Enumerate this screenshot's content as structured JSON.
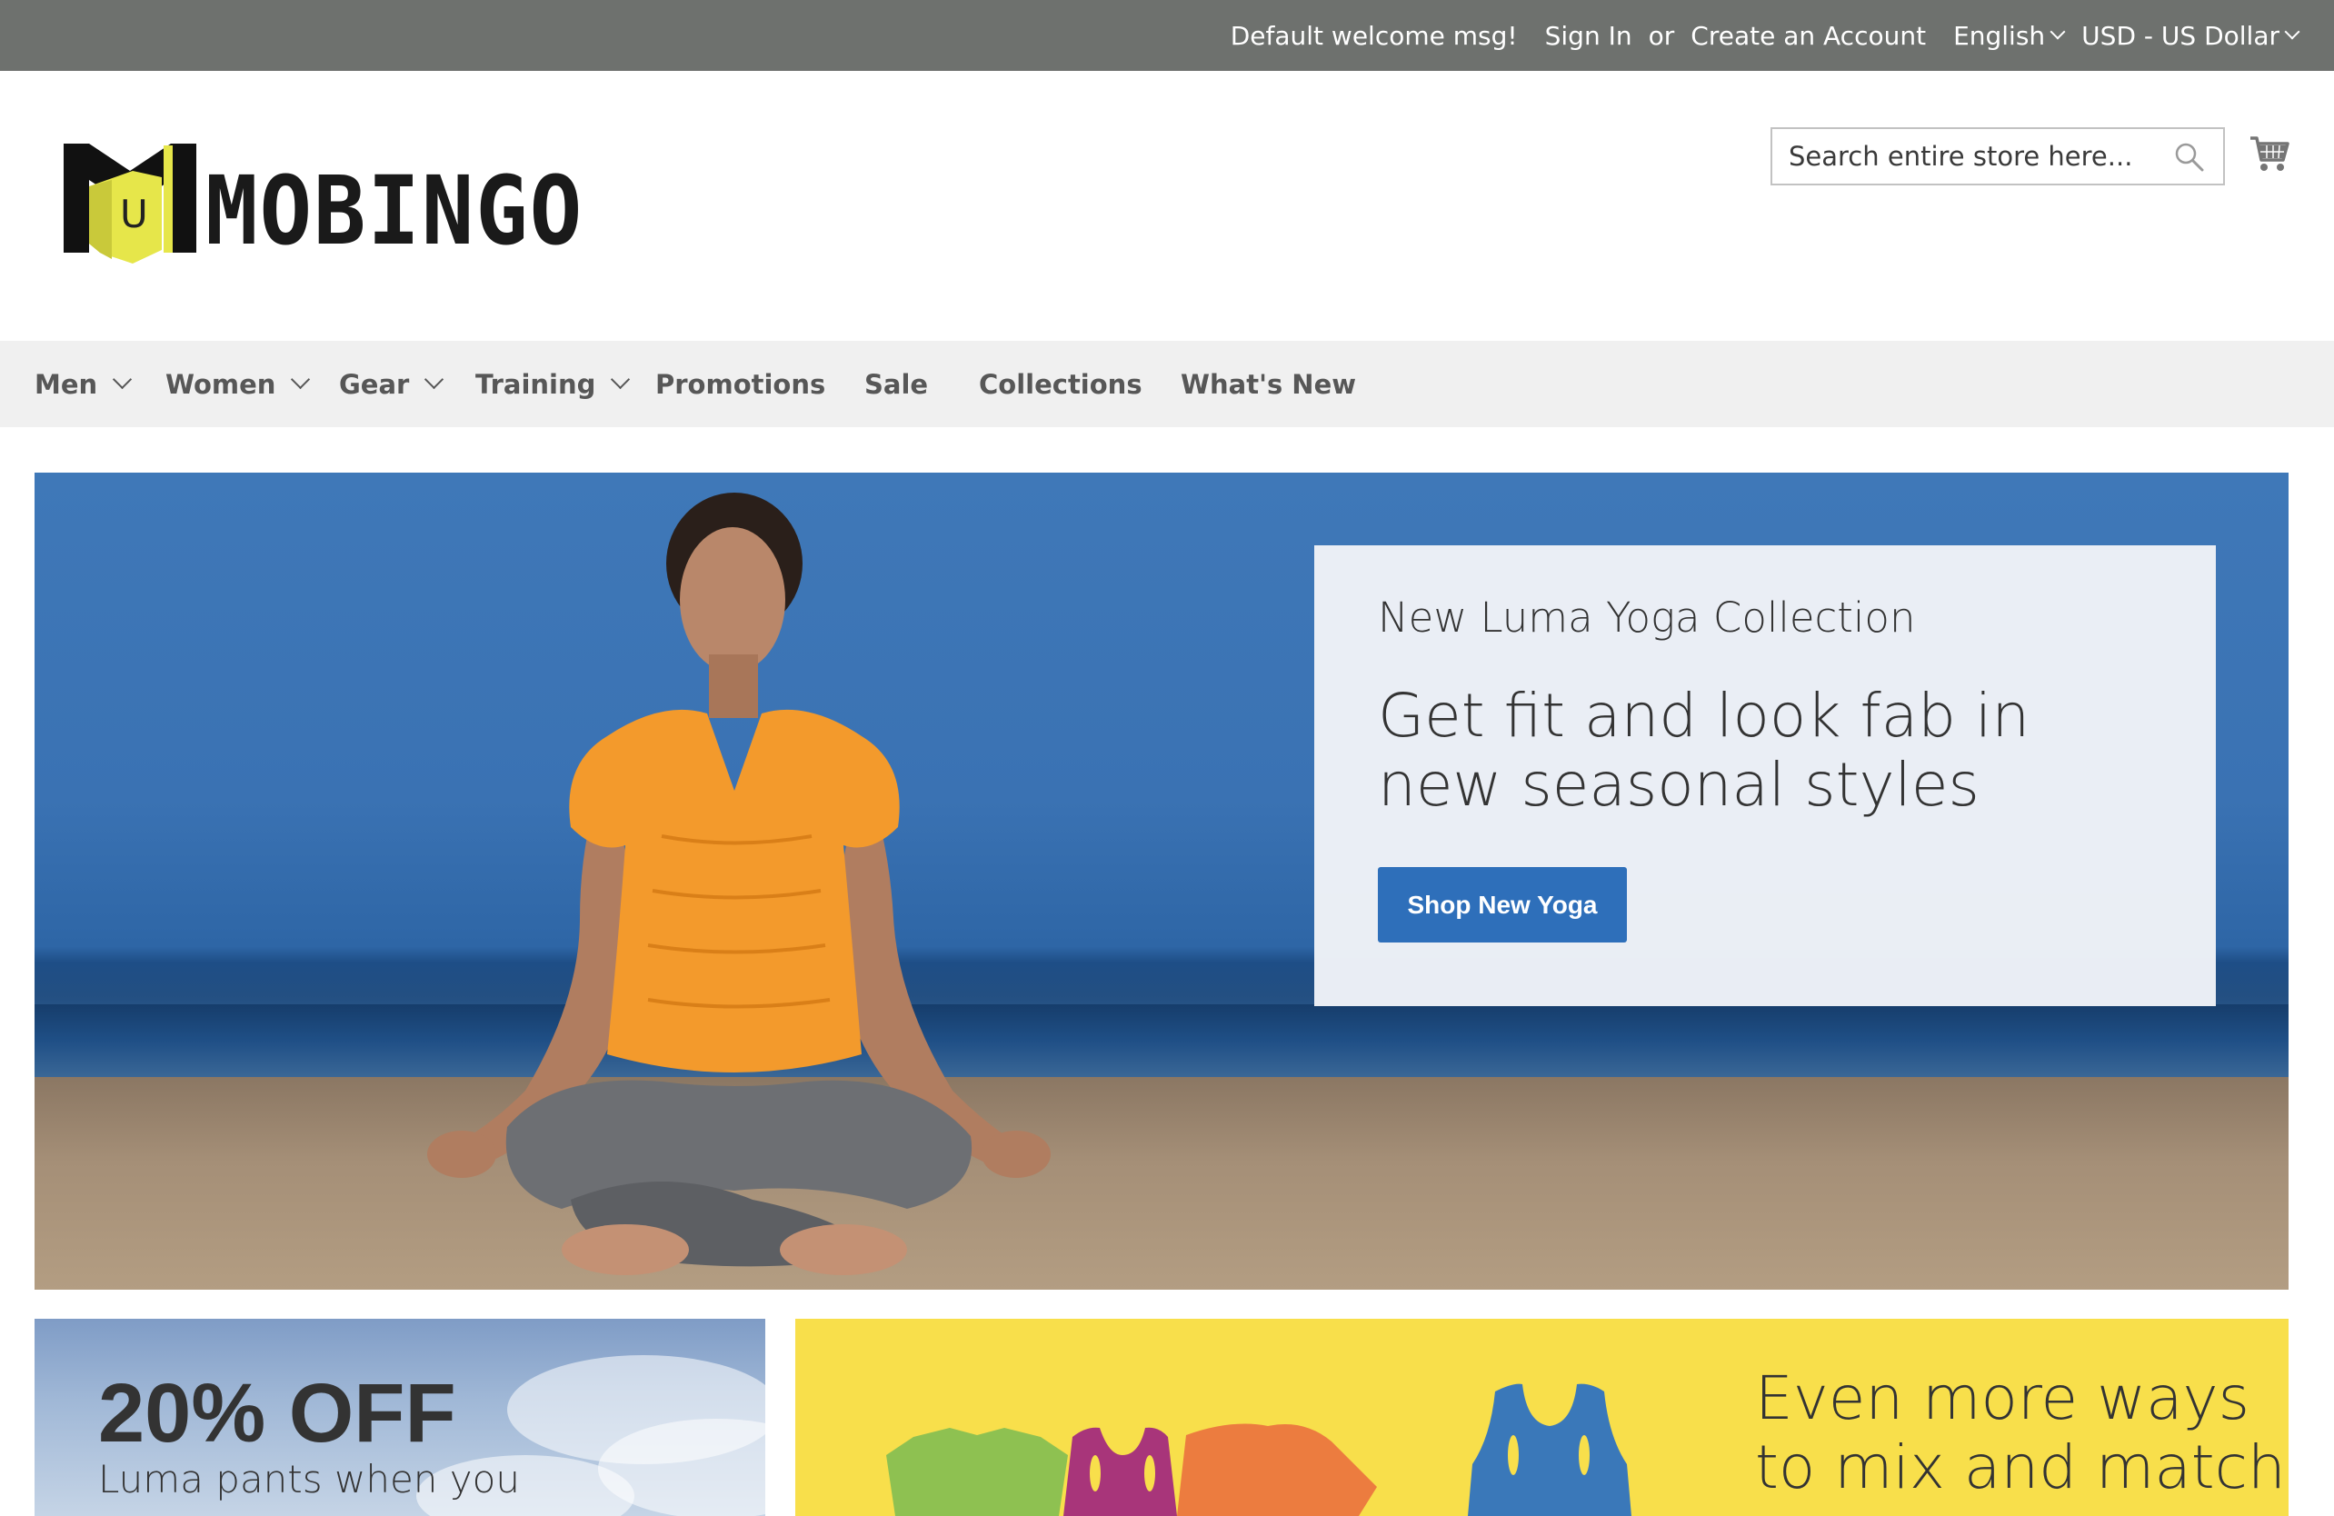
{
  "topbar": {
    "welcome": "Default welcome msg!",
    "sign_in": "Sign In",
    "or": "or",
    "create_account": "Create an Account",
    "language": "English",
    "currency": "USD - US Dollar"
  },
  "brand": {
    "logo_text": "MOBINGO",
    "logo_letter": "U"
  },
  "search": {
    "placeholder": "Search entire store here..."
  },
  "nav": {
    "items": [
      {
        "label": "Men",
        "has_dropdown": true
      },
      {
        "label": "Women",
        "has_dropdown": true
      },
      {
        "label": "Gear",
        "has_dropdown": true
      },
      {
        "label": "Training",
        "has_dropdown": true
      },
      {
        "label": "Promotions",
        "has_dropdown": false
      },
      {
        "label": "Sale",
        "has_dropdown": false
      },
      {
        "label": "Collections",
        "has_dropdown": false
      },
      {
        "label": "What's New",
        "has_dropdown": false
      }
    ]
  },
  "hero": {
    "kicker": "New Luma Yoga Collection",
    "headline": "Get fit and look fab in new seasonal styles",
    "cta": "Shop New Yoga"
  },
  "promos": {
    "pants_title": "20% OFF",
    "pants_sub": "Luma pants when you",
    "mix_line1": "Even more ways",
    "mix_line2": "to mix and match"
  },
  "colors": {
    "topbar": "#6e716e",
    "nav_bg": "#f0f0f0",
    "cta": "#2e6fba",
    "mix_tile": "#f8df4b",
    "logo_accent": "#e6e64a"
  }
}
